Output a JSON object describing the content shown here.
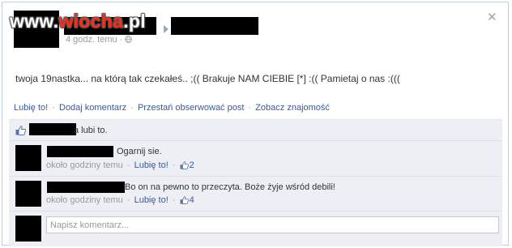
{
  "watermark": {
    "prefix": "www.",
    "accent": "wiocha",
    "suffix": ".pl"
  },
  "post": {
    "time": "4 godz. temu",
    "privacy_sep": "·",
    "text": "twoja 19nastka... na którą tak czekałeś.. ;(( Brakuje NAM CIEBIE [*] :(( Pamietaj o nas :((("
  },
  "actions": {
    "like": "Lubię to!",
    "comment": "Dodaj komentarz",
    "unfollow": "Przestań obserwować post",
    "see_friendship": "Zobacz znajomość",
    "separator": "·"
  },
  "likes": {
    "text": "a lubi to."
  },
  "comments": [
    {
      "text": "Ogarnij sie.",
      "time": "około godziny temu",
      "like_label": "Lubię to!",
      "like_count": "2"
    },
    {
      "text": "Bo on na pewno to przeczyta. Boże żyje wśród debili!",
      "time": "około godziny temu",
      "like_label": "Lubię to!",
      "like_count": "4"
    }
  ],
  "comment_input": {
    "placeholder": "Napisz komentarz..."
  },
  "colors": {
    "link": "#3b5998",
    "feedback_bg": "#edeff4",
    "watermark_accent": "#ff2a1a"
  },
  "icons": {
    "close": "close-icon",
    "like": "thumbs-up-icon",
    "globe": "globe-icon"
  }
}
